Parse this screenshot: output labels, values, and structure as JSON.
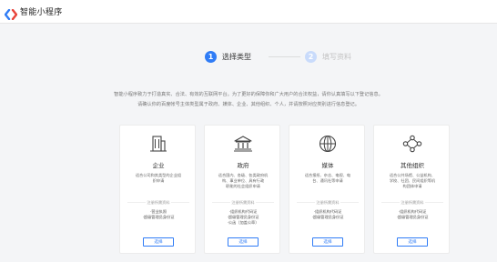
{
  "header": {
    "app_title": "智能小程序"
  },
  "steps": [
    {
      "number": "1",
      "label": "选择类型",
      "state": "active",
      "color": "#2f7cf6"
    },
    {
      "number": "2",
      "label": "填写资料",
      "state": "inactive",
      "color": "#c9dbfb"
    }
  ],
  "intro": {
    "line1": "智能小程序致力于打造真实、合法、有效的互联网平台。为了更好的保障你和广大用户的合法权益，请你认真填写以下登记信息。",
    "line2": "请确认你的百度帐号主体类型属于政府、媒体、企业、其他组织、个人，并请按照对应类别进行信息登记。"
  },
  "cards": [
    {
      "icon": "building-icon",
      "title": "企业",
      "desc": [
        "适合公司和其类型的企业组",
        "织申请"
      ],
      "docs_header": "注册所需资料",
      "docs": [
        "·营业执照",
        "·超级管理员身份证"
      ],
      "button": "选择"
    },
    {
      "icon": "government-icon",
      "title": "政府",
      "desc": [
        "适合国内、各级、各类政府机",
        "构、事业单位、具有行政",
        "职能的社会组织申请"
      ],
      "docs_header": "注册所需资料",
      "docs": [
        "·组织机构代码证",
        "·超级管理员身份证",
        "·公函（加盖公章）"
      ],
      "button": "选择"
    },
    {
      "icon": "globe-icon",
      "title": "媒体",
      "desc": [
        "适合报纸、杂志、电视、电",
        "台、通讯社等申请"
      ],
      "docs_header": "注册所需资料",
      "docs": [
        "·组织机构代码证",
        "·超级管理员身份证"
      ],
      "button": "选择"
    },
    {
      "icon": "network-icon",
      "title": "其他组织",
      "desc": [
        "适合公共场馆、公益机构、",
        "学校、社团、民间组织等机",
        "构团体申请"
      ],
      "docs_header": "注册所需资料",
      "docs": [
        "·组织机构代码证",
        "·超级管理员身份证"
      ],
      "button": "选择"
    }
  ]
}
